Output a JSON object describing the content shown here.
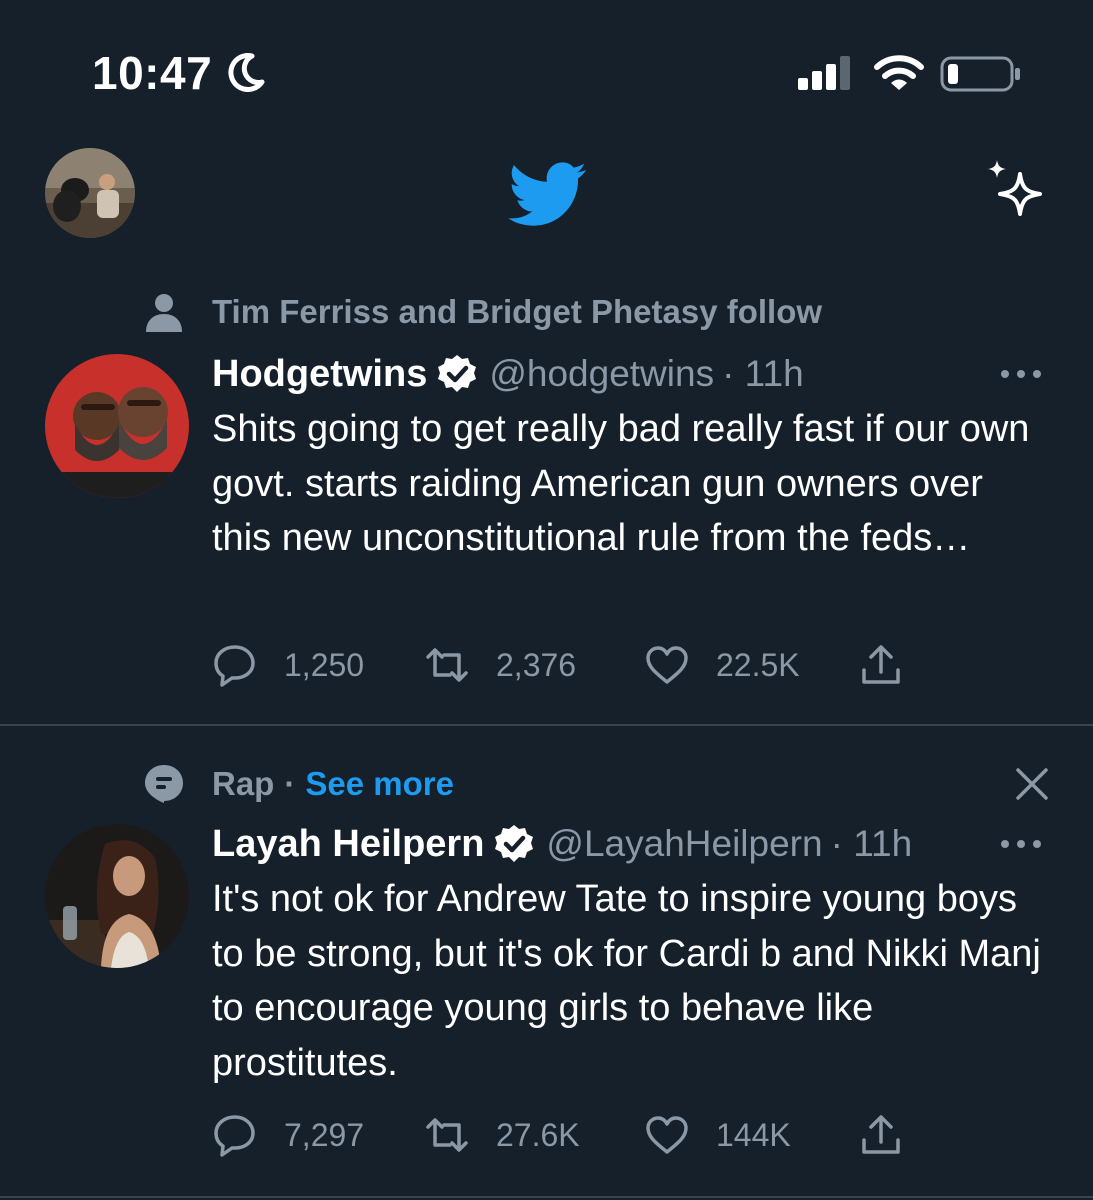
{
  "status_bar": {
    "time": "10:47"
  },
  "header": {
    "logo": "twitter-bird-icon",
    "accent_color": "#1d9bf0"
  },
  "tweets": [
    {
      "context": "Tim Ferriss and Bridget Phetasy follow",
      "context_icon": "person-icon",
      "name": "Hodgetwins",
      "handle": "@hodgetwins",
      "time": "· 11h",
      "verified": true,
      "text": "Shits going to get really bad really fast if our own govt. starts raiding American gun owners over this new unconstitutional rule from the feds…",
      "replies": "1,250",
      "retweets": "2,376",
      "likes": "22.5K"
    },
    {
      "context": "Rap",
      "context_sep": "·",
      "context_link": "See more",
      "context_icon": "topic-icon",
      "name": "Layah Heilpern",
      "handle": "@LayahHeilpern",
      "time": "· 11h",
      "verified": true,
      "text": "It's not ok for Andrew Tate to inspire young boys to be strong, but it's ok for Cardi b and Nikki Manj to encourage young girls to behave like prostitutes.",
      "replies": "7,297",
      "retweets": "27.6K",
      "likes": "144K"
    }
  ],
  "colors": {
    "background": "#15202b",
    "secondary_text": "#8b98a5",
    "divider": "#38444d",
    "link": "#1d9bf0"
  }
}
